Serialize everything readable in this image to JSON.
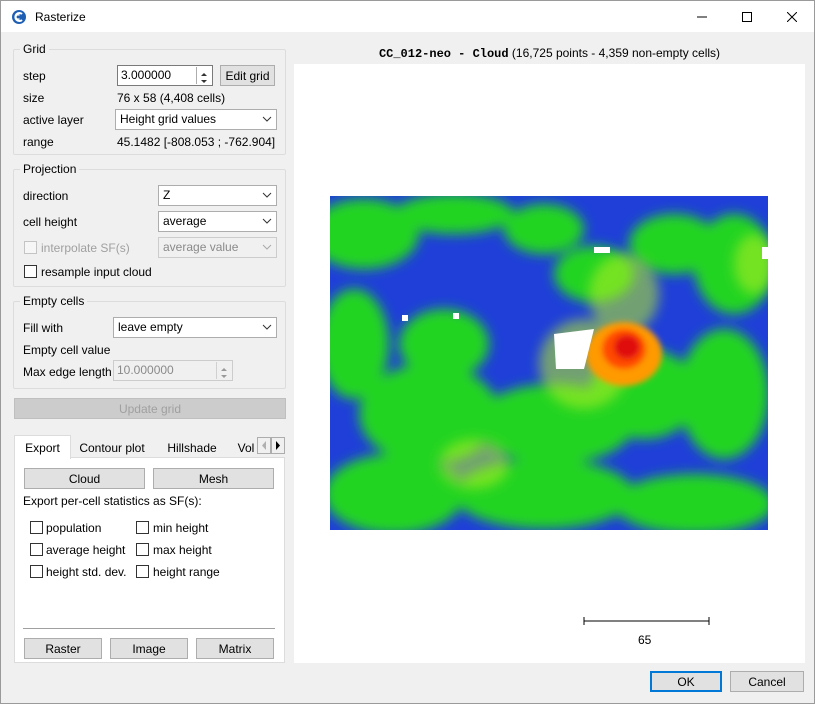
{
  "window": {
    "title": "Rasterize",
    "icon": "cloudcompare-logo-icon"
  },
  "grid": {
    "title": "Grid",
    "step_label": "step",
    "step_value": "3.000000",
    "edit_grid_label": "Edit grid",
    "size_label": "size",
    "size_value": "76 x 58 (4,408 cells)",
    "active_layer_label": "active layer",
    "active_layer_value": "Height grid values",
    "range_label": "range",
    "range_value": "45.1482 [-808.053 ; -762.904]"
  },
  "projection": {
    "title": "Projection",
    "direction_label": "direction",
    "direction_value": "Z",
    "cell_height_label": "cell height",
    "cell_height_value": "average",
    "interpolate_label": "interpolate SF(s)",
    "interpolate_value": "average value",
    "resample_label": "resample input cloud"
  },
  "empty_cells": {
    "title": "Empty cells",
    "fill_with_label": "Fill with",
    "fill_with_value": "leave empty",
    "empty_cell_value_label": "Empty cell value",
    "max_edge_label": "Max edge length",
    "max_edge_value": "10.000000"
  },
  "update_grid_label": "Update grid",
  "tabs": {
    "items": [
      "Export",
      "Contour plot",
      "Hillshade",
      "Vol"
    ],
    "active": "Export"
  },
  "export": {
    "cloud_label": "Cloud",
    "mesh_label": "Mesh",
    "stats_title": "Export per-cell statistics as SF(s):",
    "population_label": "population",
    "min_height_label": "min height",
    "average_height_label": "average height",
    "max_height_label": "max height",
    "std_dev_label": "height std. dev.",
    "height_range_label": "height range",
    "raster_label": "Raster",
    "image_label": "Image",
    "matrix_label": "Matrix"
  },
  "view": {
    "title_bold": "CC_012-neo - Cloud",
    "title_rest": " (16,725 points - 4,359 non-empty cells)",
    "scale_label": "65",
    "colors": {
      "low": "#1f3fd8",
      "mid": "#22d422",
      "high": "#e01010",
      "empty": "#ffffff"
    }
  },
  "dialog": {
    "ok_label": "OK",
    "cancel_label": "Cancel"
  }
}
